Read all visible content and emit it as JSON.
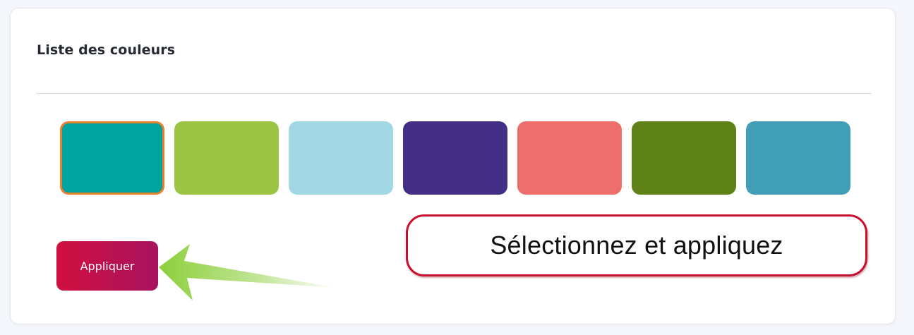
{
  "panel": {
    "title": "Liste des couleurs"
  },
  "palette": {
    "selected_index": 0,
    "selection_border_color": "#e87e2e",
    "colors": [
      "#00a39e",
      "#9cc544",
      "#a2d8e4",
      "#432f86",
      "#ee6e6e",
      "#5e8217",
      "#41a0b7"
    ]
  },
  "apply_button": {
    "label": "Appliquer",
    "gradient_start": "#d0103f",
    "gradient_end": "#a8125e"
  },
  "annotation": {
    "callout_text": "Sélectionnez et appliquez",
    "callout_border_color": "#c8102e",
    "arrow_icon": "arrow-left-icon",
    "arrow_color": "#8ccf3c"
  }
}
